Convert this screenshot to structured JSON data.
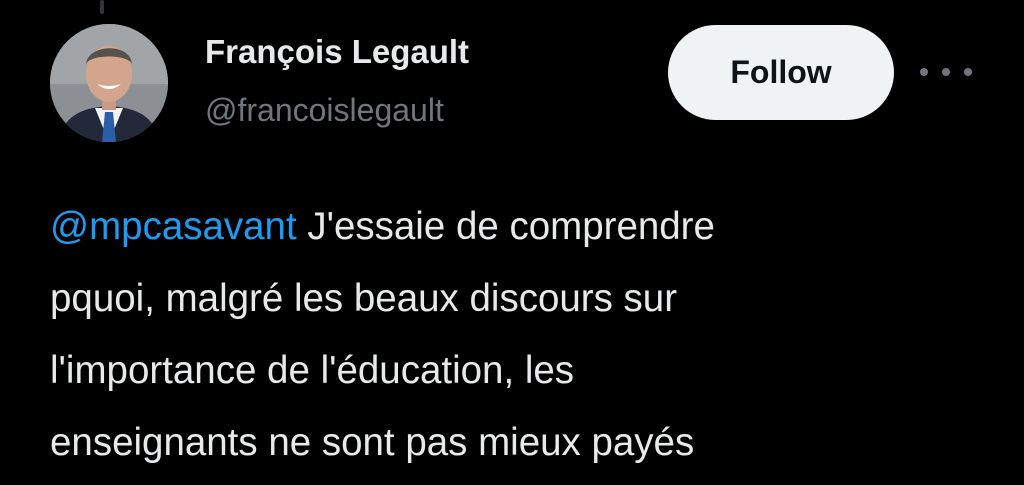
{
  "author": {
    "display_name": "François Legault",
    "handle": "@francoislegault"
  },
  "follow_button": {
    "label": "Follow"
  },
  "tweet": {
    "mention": "@mpcasavant",
    "lines": [
      " J'essaie de comprendre",
      "pquoi, malgré les beaux discours sur",
      "l'importance de l'éducation, les",
      "enseignants ne sont pas mieux payés"
    ]
  },
  "colors": {
    "background": "#000000",
    "primary_text": "#e7e9ea",
    "secondary_text": "#71767b",
    "mention": "#1d9bf0",
    "follow_button_bg": "#eff3f4",
    "follow_button_text": "#0f1419"
  },
  "icons": {
    "more": "more-horizontal-icon"
  }
}
